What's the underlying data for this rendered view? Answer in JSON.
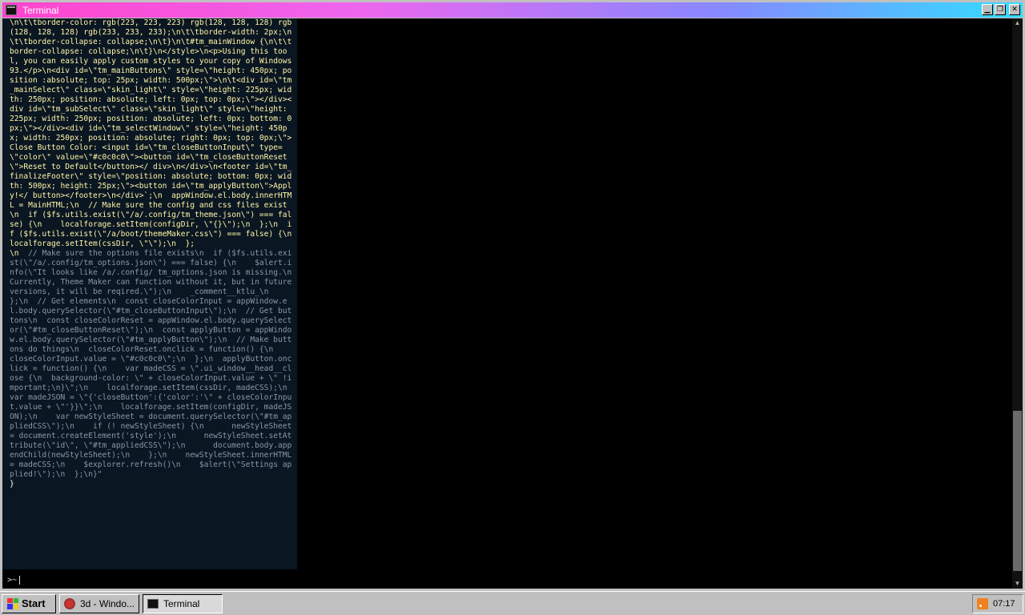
{
  "window": {
    "title": "Terminal",
    "buttons": {
      "minimize": "▁",
      "maximize": "❐",
      "close": "✕"
    }
  },
  "terminal": {
    "output_highlight": "\\n\\t\\tborder-color: rgb(223, 223, 223) rgb(128, 128, 128) rgb(128, 128, 128) rgb(233, 233, 233);\\n\\t\\tborder-width: 2px;\\n\\t\\tborder-collapse: collapse;\\n\\t}\\n\\t#tm_mainWindow {\\n\\t\\tborder-collapse: collapse;\\n\\t}\\n</style>\\n<p>Using this tool, you can easily apply custom styles to your copy of Windows 93.</p>\\n<div id=\\\"tm_mainButtons\\\" style=\\\"height: 450px; position :absolute; top: 25px; width: 500px;\\\">\\n\\t<div id=\\\"tm_mainSelect\\\" class=\\\"skin_light\\\" style=\\\"height: 225px; width: 250px; position: absolute; left: 0px; top: 0px;\\\"></div><div id=\\\"tm_subSelect\\\" class=\\\"skin_light\\\" style=\\\"height: 225px; width: 250px; position: absolute; left: 0px; bottom: 0px;\\\"></div><div id=\\\"tm_selectWindow\\\" style=\\\"height: 450px; width: 250px; position: absolute; right: 0px; top: 0px;\\\">Close Button Color: <input id=\\\"tm_closeButtonInput\\\" type=\\\"color\\\" value=\\\"#c0c0c0\\\"><button id=\\\"tm_closeButtonReset\\\">Reset to Default</button></ div>\\n</div>\\n<footer id=\\\"tm_finalizeFooter\\\" style=\\\"position: absolute; bottom: 0px; width: 500px; height: 25px;\\\"><button id=\\\"tm_applyButton\\\">Apply!</ button></footer>\\n</div>`;\\n  appWindow.el.body.innerHTML = MainHTML;\\n  // Make sure the config and css files exist\\n  if ($fs.utils.exist(\\\"/a/.config/tm_theme.json\\\") === false) {\\n    localforage.setItem(configDir, \\\"{}\\\");\\n  };\\n  if ($fs.utils.exist(\\\"/a/boot/themeMaker.css\\\") === false) {\\n    localforage.setItem(cssDir, \\\"\\\");\\n  };\n\\n",
    "output_dim": "  // Make sure the options file exists\\n  if ($fs.utils.exist(\\\"/a/.config/tm_options.json\\\") === false) {\\n    $alert.info(\\\"It looks like /a/.config/ tm_options.json is missing.\\nCurrently, Theme Maker can function without it, but in future versions, it will be reqired.\\\");\\n    _comment__ktlu_\\n  };\\n  // Get elements\\n  const closeColorInput = appWindow.el.body.querySelector(\\\"#tm_closeButtonInput\\\");\\n  // Get buttons\\n  const closeColorReset = appWindow.el.body.querySelector(\\\"#tm_closeButtonReset\\\");\\n  const applyButton = appWindow.el.body.querySelector(\\\"#tm_applyButton\\\");\\n  // Make buttons do things\\n  closeColorReset.onclick = function() {\\n    closeColorInput.value = \\\"#c0c0c0\\\";\\n  };\\n  applyButton.onclick = function() {\\n    var madeCSS = \\\".ui_window__head__close {\\n  background-color: \\\" + closeColorInput.value + \\\" !important;\\n}\\\";\\n    localforage.setItem(cssDir, madeCSS);\\n    var madeJSON = \\\"{'closeButton':{'color':'\\\" + closeColorInput.value + \\\"'}}\\\";\\n    localforage.setItem(configDir, madeJSON);\\n    var newStyleSheet = document.querySelector(\\\"#tm_appliedCSS\\\");\\n    if (! newStyleSheet) {\\n      newStyleSheet = document.createElement('style');\\n      newStyleSheet.setAttribute(\\\"id\\\", \\\"#tm_appliedCSS\\\");\\n      document.body.appendChild(newStyleSheet);\\n    };\\n    newStyleSheet.innerHTML = madeCSS;\\n    $explorer.refresh()\\n    $alert(\\\"Settings applied!\\\");\\n  };\\n}\"",
    "output_end": "}",
    "prompt": ">~"
  },
  "taskbar": {
    "start_label": "Start",
    "tasks": [
      {
        "label": "3d - Windo..."
      },
      {
        "label": "Terminal"
      }
    ],
    "clock": "07:17"
  },
  "colors": {
    "title_gradient": [
      "#ff44cc",
      "#33ddff"
    ],
    "terminal_bg": "#000000",
    "output_bg": "#0a1622",
    "output_text": "#fff7a8"
  }
}
